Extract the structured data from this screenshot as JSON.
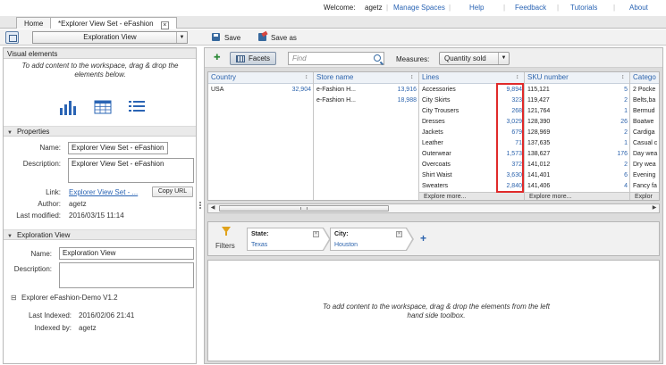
{
  "header": {
    "welcome_label": "Welcome:",
    "user": "agetz",
    "links": [
      "Manage Spaces",
      "Help",
      "Feedback",
      "Tutorials",
      "About"
    ]
  },
  "tabs": {
    "home": "Home",
    "active": "*Explorer View Set - eFashion",
    "close_glyph": "×"
  },
  "toolbar": {
    "view_select": "Exploration View",
    "save": "Save",
    "save_as": "Save as"
  },
  "visual_elements": {
    "title": "Visual elements",
    "message": "To add content to the workspace, drag & drop the elements below.",
    "icons": [
      "bar-chart-icon",
      "table-icon",
      "list-icon"
    ]
  },
  "properties": {
    "title": "Properties",
    "name_label": "Name:",
    "name_value": "Explorer View Set - eFashion",
    "description_label": "Description:",
    "description_value": "Explorer View Set - eFashion",
    "link_label": "Link:",
    "link_value": "Explorer View Set - ...",
    "copy_url": "Copy URL",
    "author_label": "Author:",
    "author_value": "agetz",
    "last_modified_label": "Last modified:",
    "last_modified_value": "2016/03/15 11:14"
  },
  "exploration_view": {
    "title": "Exploration View",
    "name_label": "Name:",
    "name_value": "Exploration View",
    "description_label": "Description:",
    "description_value": "",
    "source_toggle": "⊟",
    "source_name": "Explorer eFashion-Demo V1.2",
    "last_indexed_label": "Last Indexed:",
    "last_indexed_value": "2016/02/06 21:41",
    "indexed_by_label": "Indexed by:",
    "indexed_by_value": "agetz"
  },
  "facet_toolbar": {
    "facets": "Facets",
    "find_placeholder": "Find",
    "measures_label": "Measures:",
    "measure_selected": "Quantity sold"
  },
  "facets": {
    "country": {
      "header": "Country",
      "rows": [
        {
          "label": "USA",
          "value": "32,904"
        }
      ]
    },
    "store": {
      "header": "Store name",
      "rows": [
        {
          "label": "e-Fashion H...",
          "value": "13,916"
        },
        {
          "label": "e-Fashion H...",
          "value": "18,988"
        }
      ]
    },
    "lines": {
      "header": "Lines",
      "rows": [
        {
          "label": "Accessories",
          "value": "9,894"
        },
        {
          "label": "City Skirts",
          "value": "323"
        },
        {
          "label": "City Trousers",
          "value": "268"
        },
        {
          "label": "Dresses",
          "value": "3,029"
        },
        {
          "label": "Jackets",
          "value": "679"
        },
        {
          "label": "Leather",
          "value": "71"
        },
        {
          "label": "Outerwear",
          "value": "1,573"
        },
        {
          "label": "Overcoats",
          "value": "372"
        },
        {
          "label": "Shirt Waist",
          "value": "3,630"
        },
        {
          "label": "Sweaters",
          "value": "2,840"
        }
      ],
      "explore_more": "Explore more..."
    },
    "sku": {
      "header": "SKU number",
      "rows": [
        {
          "label": "115,121",
          "value": "5"
        },
        {
          "label": "119,427",
          "value": "2"
        },
        {
          "label": "121,764",
          "value": "1"
        },
        {
          "label": "128,390",
          "value": "26"
        },
        {
          "label": "128,969",
          "value": "2"
        },
        {
          "label": "137,635",
          "value": "1"
        },
        {
          "label": "138,627",
          "value": "176"
        },
        {
          "label": "141,012",
          "value": "2"
        },
        {
          "label": "141,401",
          "value": "6"
        },
        {
          "label": "141,406",
          "value": "4"
        }
      ],
      "explore_more": "Explore more..."
    },
    "category": {
      "header": "Catego",
      "rows": [
        {
          "label": "2 Pocke"
        },
        {
          "label": "Belts,ba"
        },
        {
          "label": "Bermud"
        },
        {
          "label": "Boatwe"
        },
        {
          "label": "Cardiga"
        },
        {
          "label": "Casual c"
        },
        {
          "label": "Day wea"
        },
        {
          "label": "Dry wea"
        },
        {
          "label": "Evening"
        },
        {
          "label": "Fancy fa"
        }
      ],
      "explore_more": "Explor"
    }
  },
  "scrollbar": {
    "left_arrow": "◀",
    "right_arrow": "▶"
  },
  "filters": {
    "label": "Filters",
    "chips": [
      {
        "title": "State:",
        "value": "Texas",
        "close": "×"
      },
      {
        "title": "City:",
        "value": "Houston",
        "close": "×"
      }
    ],
    "add": "+"
  },
  "workspace": {
    "message": "To add content to the workspace, drag & drop the elements from the left hand side toolbox."
  },
  "colors": {
    "accent": "#2d64ad",
    "highlight": "#e02a2a",
    "filter_icon": "#e0a21a"
  }
}
